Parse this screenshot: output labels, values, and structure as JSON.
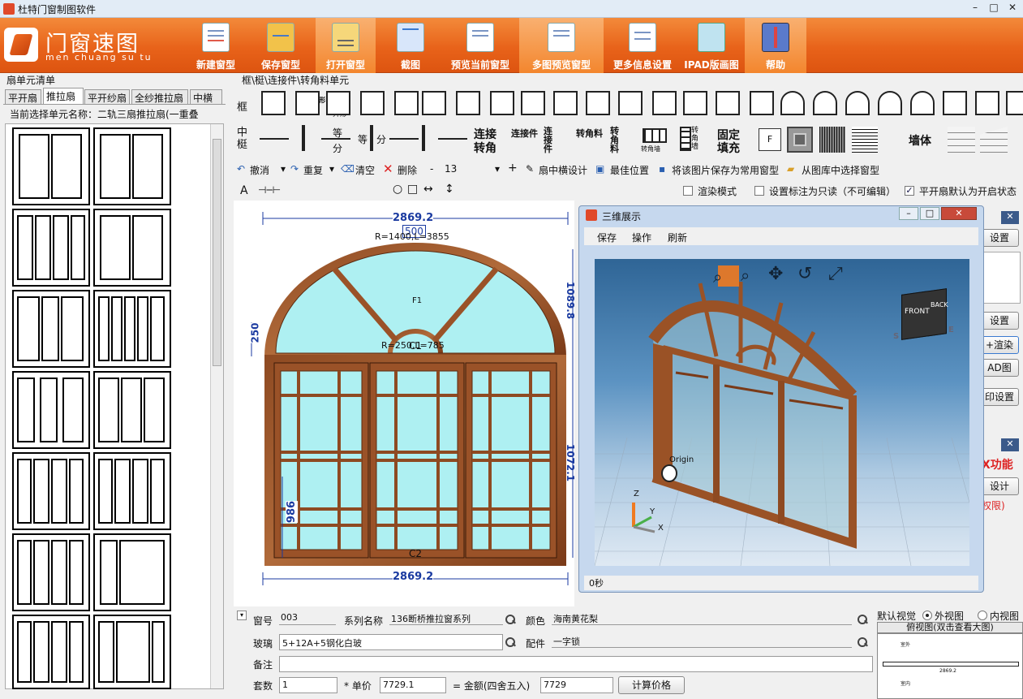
{
  "window": {
    "title": "杜特门窗制图软件",
    "min": "–",
    "max": "□",
    "close": "✕"
  },
  "logo": {
    "cn": "门窗速图",
    "py": "men chuang su tu"
  },
  "toolbar": [
    {
      "label": "新建窗型",
      "icon": "new-document-icon"
    },
    {
      "label": "保存窗型",
      "icon": "save-folder-icon"
    },
    {
      "label": "打开窗型",
      "icon": "open-folder-icon"
    },
    {
      "label": "截图",
      "icon": "screenshot-icon"
    },
    {
      "label": "预览当前窗型",
      "icon": "preview-icon"
    },
    {
      "label": "多图预览窗型",
      "icon": "multi-preview-icon"
    },
    {
      "label": "更多信息设置",
      "icon": "settings-icon"
    },
    {
      "label": "IPAD版画图",
      "icon": "ipad-icon"
    },
    {
      "label": "帮助",
      "icon": "help-icon"
    }
  ],
  "left": {
    "title": "扇单元清单",
    "tabs": [
      "平开扇",
      "推拉扇",
      "平开纱扇",
      "全纱推拉扇",
      "中横"
    ],
    "current": "当前选择单元名称：二轨三扇推拉扇(一重叠"
  },
  "profiles": {
    "path": "框\\梃\\连接件\\转角料单元",
    "row1_label": "框",
    "row2_label": "中梃",
    "diy": "DIY异形",
    "yixing": "异形",
    "eq1": "等",
    "eq2": "分",
    "eq3": "等",
    "eq4": "分",
    "conn1a": "连接",
    "conn1b": "转角",
    "conn2": "连接件",
    "conn3": "连接件",
    "turn1": "转角料",
    "turn2": "转角料",
    "turn3": "转角墙",
    "turn4": "转角墙",
    "fixed1": "固定",
    "fixed2": "填充",
    "f": "F",
    "wall": "墙体"
  },
  "edit": {
    "undo": "撤消",
    "redo": "重复",
    "clear": "清空",
    "delete": "删除",
    "minus": "-",
    "num": "13",
    "plus": "+",
    "design": "扇中横设计",
    "best": "最佳位置",
    "savepic": "将该图片保存为常用窗型",
    "fromlib": "从图库中选择窗型"
  },
  "draw": {
    "a": "A",
    "render": "渲染模式",
    "readonly": "设置标注为只读（不可编辑）",
    "openstate": "平开扇默认为开启状态"
  },
  "canvas": {
    "w_top": "2869.2",
    "w_top2": "500",
    "arc": "R=1400,L=3855",
    "h_left": "250",
    "h_right1": "1089.8",
    "inner_arc": "R=250,L=785",
    "c1": "C1",
    "f1": "F1",
    "h_986": "986",
    "c2": "C2",
    "w_bot": "2869.2",
    "h_right2": "1072.1"
  },
  "win3d": {
    "title": "三维展示",
    "menu": [
      "保存",
      "操作",
      "刷新"
    ],
    "status": "0秒",
    "front": "FRONT",
    "back": "BACK",
    "origin": "Origin",
    "ax_z": "Z",
    "ax_y": "Y",
    "ax_x": "X",
    "s": "S",
    "e": "E"
  },
  "rightstrip": {
    "b1": "设置",
    "b2": "设置",
    "b3": "+渲染",
    "b4": "AD图",
    "b5": "印设置",
    "red": "X功能",
    "b6": "设计",
    "b7": "权限)"
  },
  "bottom": {
    "no_label": "窗号",
    "no": "003",
    "series_label": "系列名称",
    "series": "136断桥推拉窗系列",
    "color_label": "颜色",
    "color": "海南黄花梨",
    "glass_label": "玻璃",
    "glass": "5+12A+5钢化白玻",
    "parts_label": "配件",
    "parts": "一字锁",
    "note_label": "备注",
    "sets_label": "套数",
    "sets": "1",
    "price_label": "* 单价",
    "price": "7729.1",
    "amount_label": "= 金额(四舍五入)",
    "amount": "7729",
    "calc": "计算价格"
  },
  "view": {
    "label": "默认视觉",
    "outer": "外视图",
    "inner": "内视图",
    "preview": "俯视图(双击查看大图)",
    "p1": "2869.2",
    "p2": "室外",
    "p3": "室内"
  }
}
